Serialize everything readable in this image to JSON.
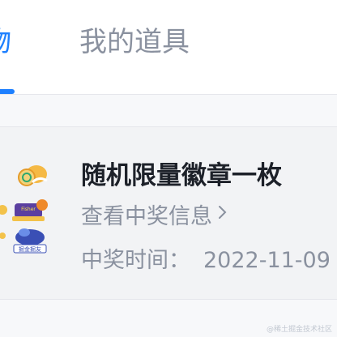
{
  "tabs": {
    "active_label": "物",
    "inactive_label": "我的道具"
  },
  "prize": {
    "title": "随机限量徽章一枚",
    "view_link": "查看中奖信息",
    "win_time_label": "中奖时间：",
    "win_date": "2022-11-09",
    "badges": [
      {
        "name": "bonus-badge-icon"
      },
      {
        "name": "fisher-badge-icon",
        "text": "Fisher"
      },
      {
        "name": "bug-badge-icon",
        "text": "掘金掘友"
      }
    ]
  },
  "watermark": "@稀土掘金技术社区",
  "colors": {
    "accent": "#1e80ff",
    "muted_text": "#8a919f",
    "title_text": "#1d2129",
    "card_bg": "#f2f3f5"
  }
}
